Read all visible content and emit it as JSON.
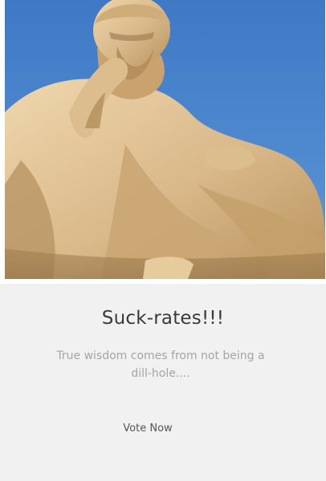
{
  "card": {
    "image": {
      "alt": "Statue of Socrates against blue sky"
    },
    "title": "Suck-rates!!!",
    "description": "True wisdom comes from not being a dill-hole....",
    "vote_button_label": "Vote Now"
  },
  "colors": {
    "background": "#f1f1f1",
    "sky": "#4a83cc",
    "stone": "#d9b889",
    "title_text": "#3a3a3a",
    "muted_text": "#a5a5a5"
  }
}
